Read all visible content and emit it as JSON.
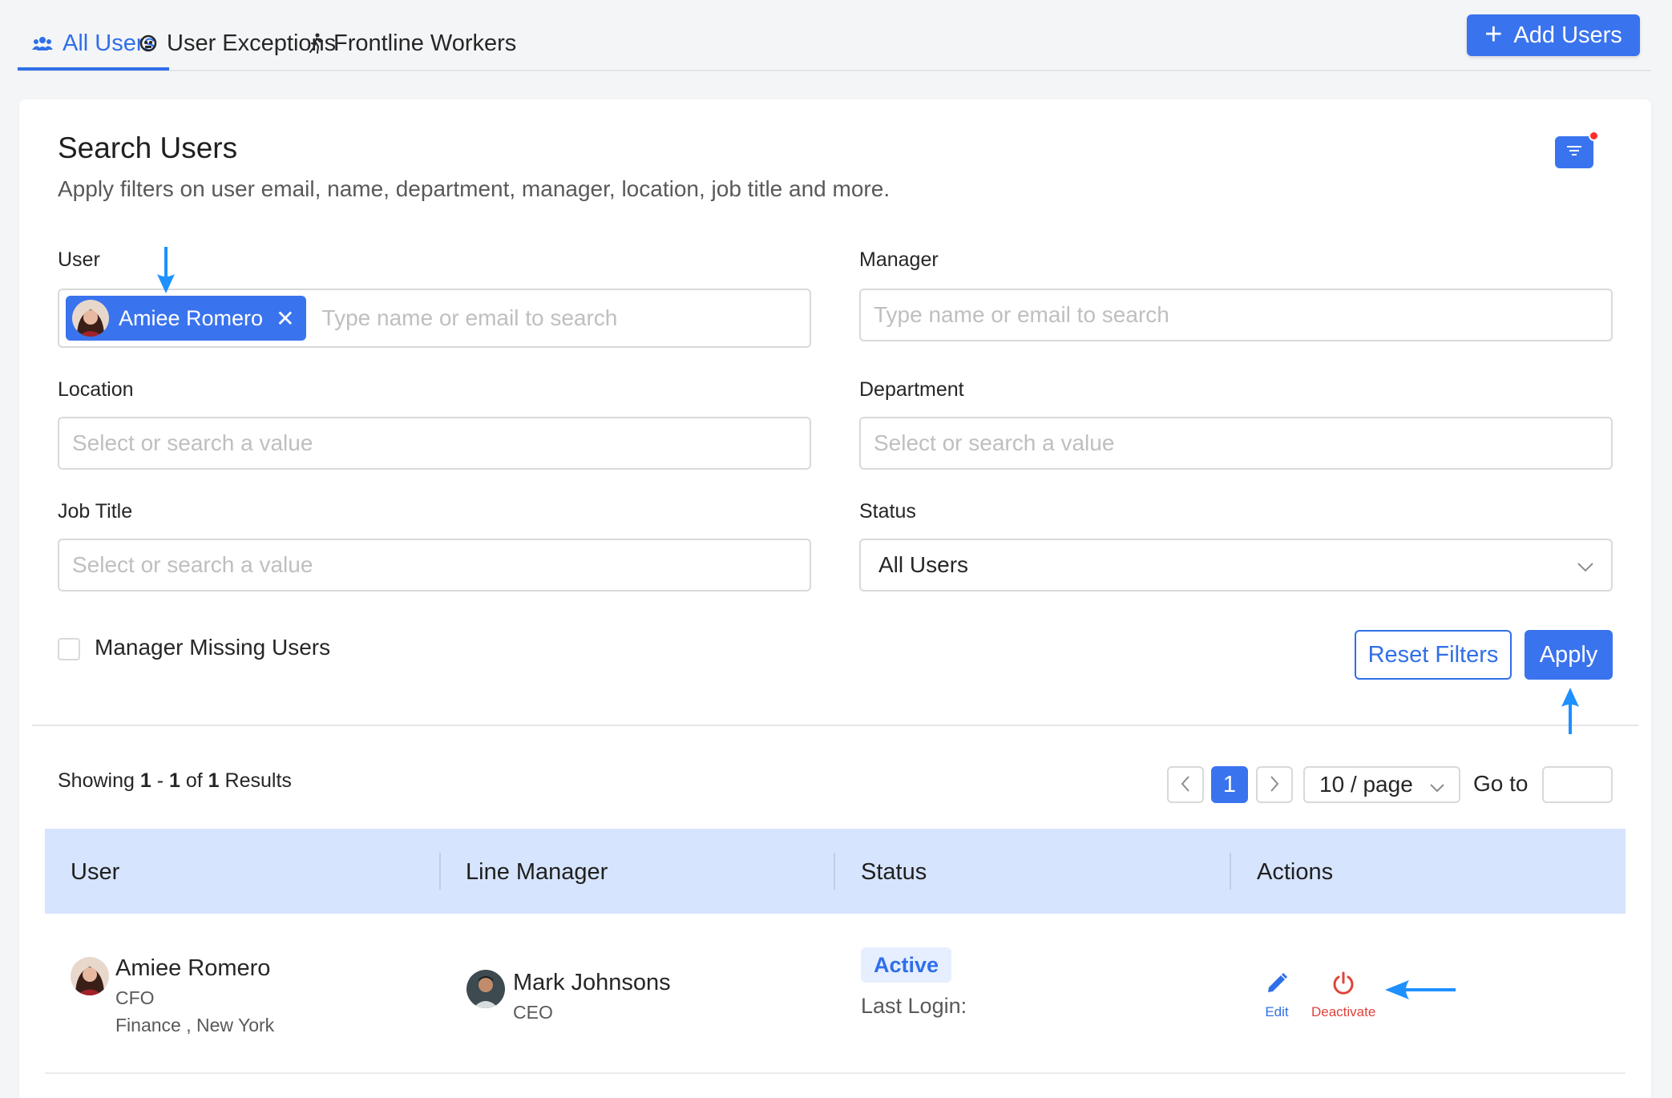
{
  "tabs": [
    {
      "label": "All Users",
      "icon": "users-icon",
      "active": true
    },
    {
      "label": "User Exceptions",
      "icon": "exception-icon",
      "active": false
    },
    {
      "label": "Frontline Workers",
      "icon": "walker-icon",
      "active": false
    }
  ],
  "add_users_label": "Add Users",
  "search": {
    "title": "Search Users",
    "subtitle": "Apply filters on user email, name, department, manager, location, job title and more.",
    "user_label": "User",
    "user_chip": "Amiee Romero",
    "user_placeholder": "Type name or email to search",
    "manager_label": "Manager",
    "manager_placeholder": "Type name or email to search",
    "location_label": "Location",
    "location_placeholder": "Select or search a value",
    "department_label": "Department",
    "department_placeholder": "Select or search a value",
    "job_title_label": "Job Title",
    "job_title_placeholder": "Select or search a value",
    "status_label": "Status",
    "status_value": "All Users",
    "manager_missing_label": "Manager Missing Users",
    "reset_label": "Reset Filters",
    "apply_label": "Apply"
  },
  "results": {
    "showing_prefix": "Showing",
    "range_start": "1",
    "range_sep": "-",
    "range_end": "1",
    "of_text": "of",
    "total": "1",
    "results_text": "Results"
  },
  "pagination": {
    "current_page": "1",
    "page_size": "10 / page",
    "goto_label": "Go to"
  },
  "table": {
    "headers": [
      "User",
      "Line Manager",
      "Status",
      "Actions"
    ],
    "rows": [
      {
        "user_name": "Amiee Romero",
        "user_title": "CFO",
        "user_dept_loc": "Finance , New York",
        "manager_name": "Mark Johnsons",
        "manager_title": "CEO",
        "status": "Active",
        "last_login_label": "Last Login:",
        "edit_label": "Edit",
        "deactivate_label": "Deactivate"
      }
    ]
  },
  "colors": {
    "primary": "#3a73ee",
    "danger": "#e0423b",
    "table_header_bg": "#d6e4fd",
    "annotation_arrow": "#1e90ff"
  }
}
